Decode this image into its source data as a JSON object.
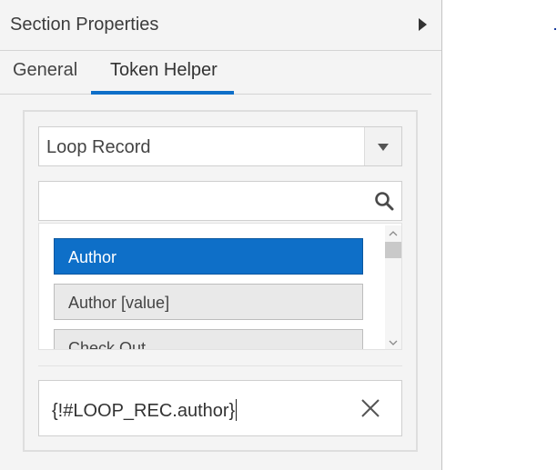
{
  "panel": {
    "title": "Section Properties",
    "toggle_icon": "triangle-right-icon"
  },
  "tabs": [
    {
      "label": "General",
      "active": false
    },
    {
      "label": "Token Helper",
      "active": true
    }
  ],
  "colors": {
    "accent": "#0e6fc8",
    "panel_bg": "#f4f4f4"
  },
  "token_helper": {
    "record_select": {
      "value": "Loop Record"
    },
    "search": {
      "value": "",
      "placeholder": ""
    },
    "list_items": [
      {
        "label": "Author",
        "selected": true
      },
      {
        "label": "Author [value]",
        "selected": false
      },
      {
        "label": "Check Out",
        "selected": false
      }
    ],
    "token_value": "{!#LOOP_REC.author}"
  }
}
